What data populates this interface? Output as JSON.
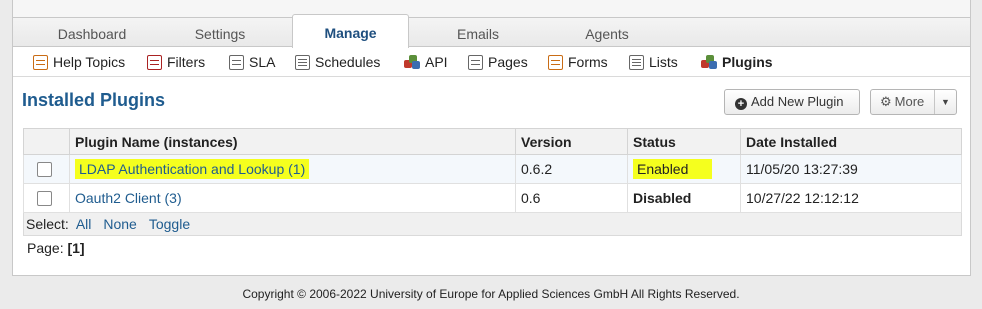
{
  "nav": {
    "tabs": [
      {
        "label": "Dashboard"
      },
      {
        "label": "Settings"
      },
      {
        "label": "Manage"
      },
      {
        "label": "Emails"
      },
      {
        "label": "Agents"
      }
    ]
  },
  "subnav": {
    "items": [
      {
        "label": "Help Topics",
        "icon": "help-topics-icon"
      },
      {
        "label": "Filters",
        "icon": "filters-icon"
      },
      {
        "label": "SLA",
        "icon": "sla-icon"
      },
      {
        "label": "Schedules",
        "icon": "schedules-icon"
      },
      {
        "label": "API",
        "icon": "api-icon"
      },
      {
        "label": "Pages",
        "icon": "pages-icon"
      },
      {
        "label": "Forms",
        "icon": "forms-icon"
      },
      {
        "label": "Lists",
        "icon": "lists-icon"
      },
      {
        "label": "Plugins",
        "icon": "plugins-icon"
      }
    ]
  },
  "page": {
    "title": "Installed Plugins",
    "add_button": "Add New Plugin",
    "more_button": "More"
  },
  "table": {
    "headers": {
      "name": "Plugin Name (instances)",
      "version": "Version",
      "status": "Status",
      "date": "Date Installed"
    },
    "rows": [
      {
        "name": "LDAP Authentication and Lookup (1)",
        "version": "0.6.2",
        "status": "Enabled",
        "date": "11/05/20 13:27:39"
      },
      {
        "name": "Oauth2 Client (3)",
        "version": "0.6",
        "status": "Disabled",
        "date": "10/27/22 12:12:12"
      }
    ]
  },
  "select": {
    "label": "Select:",
    "all": "All",
    "none": "None",
    "toggle": "Toggle"
  },
  "pager": {
    "label": "Page:",
    "current": "[1]"
  },
  "footer": {
    "text": "Copyright © 2006-2022 University of Europe for Applied Sciences GmbH All Rights Reserved."
  },
  "colors": {
    "link": "#1f5c8f",
    "highlight": "#f5ff1e"
  }
}
